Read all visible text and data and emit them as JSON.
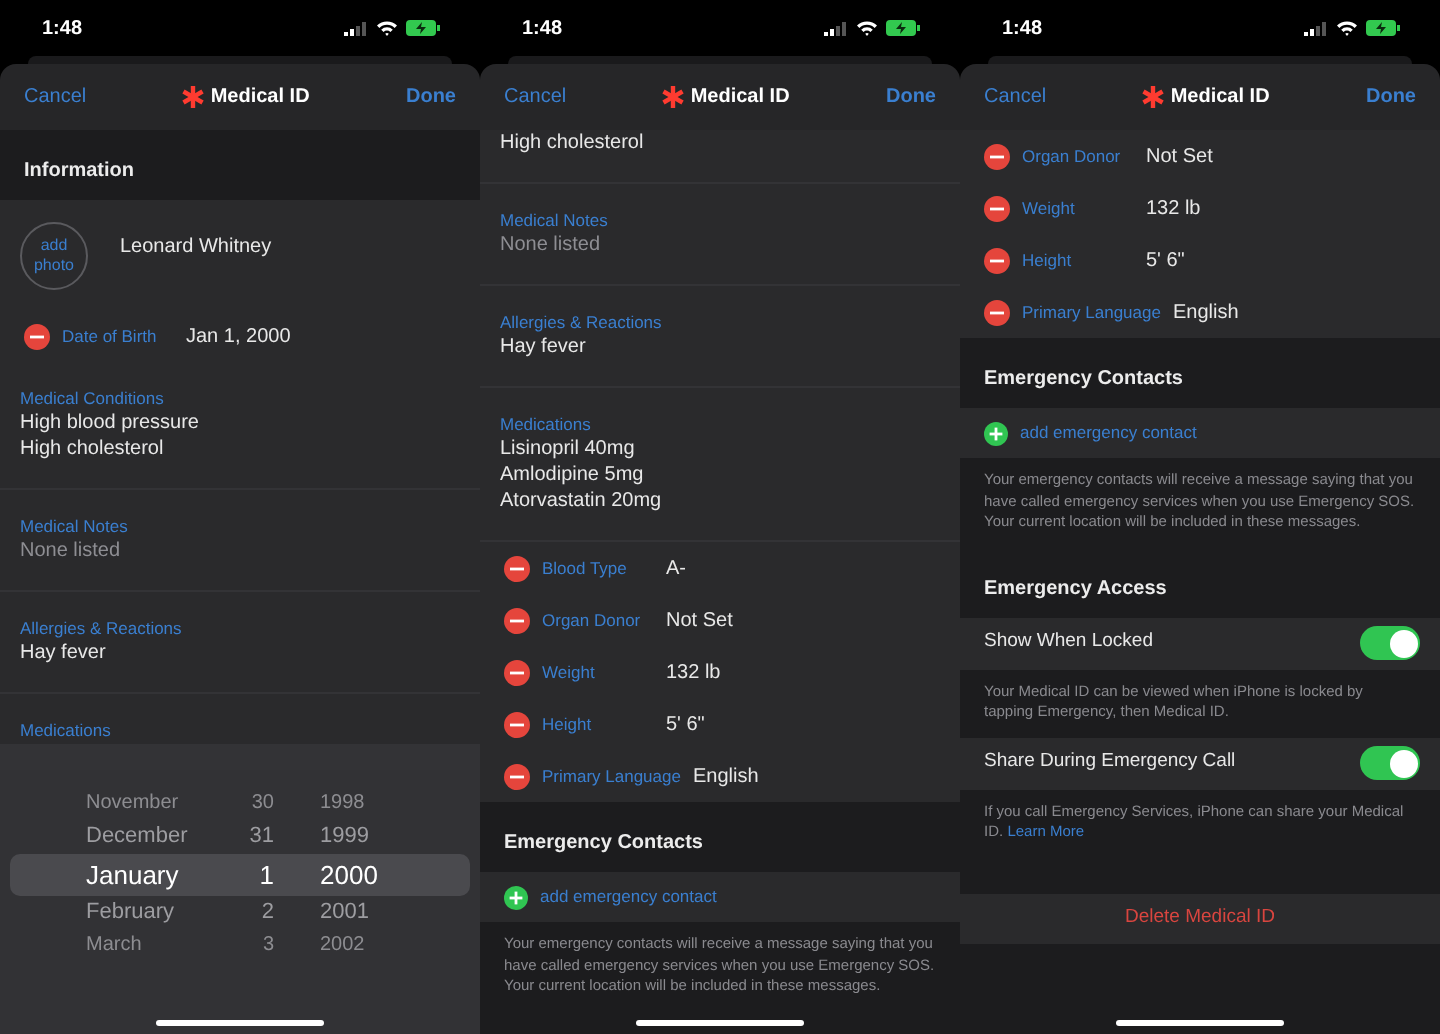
{
  "screens": [
    {
      "time": "1:48",
      "nav": {
        "cancel": "Cancel",
        "title": "Medical ID",
        "done": "Done"
      },
      "items": [
        {
          "kind": "header",
          "text": "Information"
        },
        {
          "kind": "profile",
          "photo": "add photo",
          "name": "Leonard Whitney"
        },
        {
          "kind": "field",
          "label": "Date of Birth",
          "value": "Jan 1, 2000"
        },
        {
          "kind": "block",
          "label": "Medical Conditions",
          "lines": [
            "High blood pressure",
            "High cholesterol"
          ]
        },
        {
          "kind": "block",
          "label": "Medical Notes",
          "lines": [
            "None listed"
          ],
          "muted": true
        },
        {
          "kind": "block",
          "label": "Allergies & Reactions",
          "lines": [
            "Hay fever"
          ]
        },
        {
          "kind": "block",
          "label": "Medications"
        }
      ],
      "picker": {
        "rows": [
          {
            "month": "November",
            "day": "30",
            "year": "1998",
            "selected": false
          },
          {
            "month": "December",
            "day": "31",
            "year": "1999",
            "selected": false
          },
          {
            "month": "January",
            "day": "1",
            "year": "2000",
            "selected": true
          },
          {
            "month": "February",
            "day": "2",
            "year": "2001",
            "selected": false
          },
          {
            "month": "March",
            "day": "3",
            "year": "2002",
            "selected": false
          }
        ]
      }
    },
    {
      "time": "1:48",
      "nav": {
        "cancel": "Cancel",
        "title": "Medical ID",
        "done": "Done"
      },
      "items": [
        {
          "kind": "block",
          "lines": [
            "High cholesterol"
          ]
        },
        {
          "kind": "block",
          "label": "Medical Notes",
          "lines": [
            "None listed"
          ],
          "muted": true
        },
        {
          "kind": "block",
          "label": "Allergies & Reactions",
          "lines": [
            "Hay fever"
          ]
        },
        {
          "kind": "block",
          "label": "Medications",
          "lines": [
            "Lisinopril 40mg",
            "Amlodipine 5mg",
            "Atorvastatin 20mg"
          ]
        },
        {
          "kind": "field",
          "label": "Blood Type",
          "value": "A-"
        },
        {
          "kind": "field",
          "label": "Organ Donor",
          "value": "Not Set"
        },
        {
          "kind": "field",
          "label": "Weight",
          "value": "132 lb"
        },
        {
          "kind": "field",
          "label": "Height",
          "value": "5' 6\""
        },
        {
          "kind": "field",
          "label": "Primary Language",
          "value": "English"
        },
        {
          "kind": "header",
          "text": "Emergency Contacts"
        },
        {
          "kind": "add",
          "text": "add emergency contact"
        },
        {
          "kind": "note",
          "text": "Your emergency contacts will receive a message saying that you have called emergency services when you use Emergency SOS. Your current location will be included in these messages."
        }
      ]
    },
    {
      "time": "1:48",
      "nav": {
        "cancel": "Cancel",
        "title": "Medical ID",
        "done": "Done"
      },
      "items": [
        {
          "kind": "field",
          "label": "Organ Donor",
          "value": "Not Set"
        },
        {
          "kind": "field",
          "label": "Weight",
          "value": "132 lb"
        },
        {
          "kind": "field",
          "label": "Height",
          "value": "5' 6\""
        },
        {
          "kind": "field",
          "label": "Primary Language",
          "value": "English"
        },
        {
          "kind": "header",
          "text": "Emergency Contacts"
        },
        {
          "kind": "add",
          "text": "add emergency contact"
        },
        {
          "kind": "note",
          "text": "Your emergency contacts will receive a message saying that you have called emergency services when you use Emergency SOS. Your current location will be included in these messages."
        },
        {
          "kind": "header",
          "text": "Emergency Access"
        },
        {
          "kind": "toggle",
          "label": "Show When Locked",
          "on": true
        },
        {
          "kind": "note",
          "text": "Your Medical ID can be viewed when iPhone is locked by tapping Emergency, then Medical ID."
        },
        {
          "kind": "toggle",
          "label": "Share During Emergency Call",
          "on": true
        },
        {
          "kind": "note",
          "text": "If you call Emergency Services, iPhone can share your Medical ID.",
          "link": "Learn More"
        },
        {
          "kind": "delete",
          "text": "Delete Medical ID"
        }
      ]
    }
  ]
}
